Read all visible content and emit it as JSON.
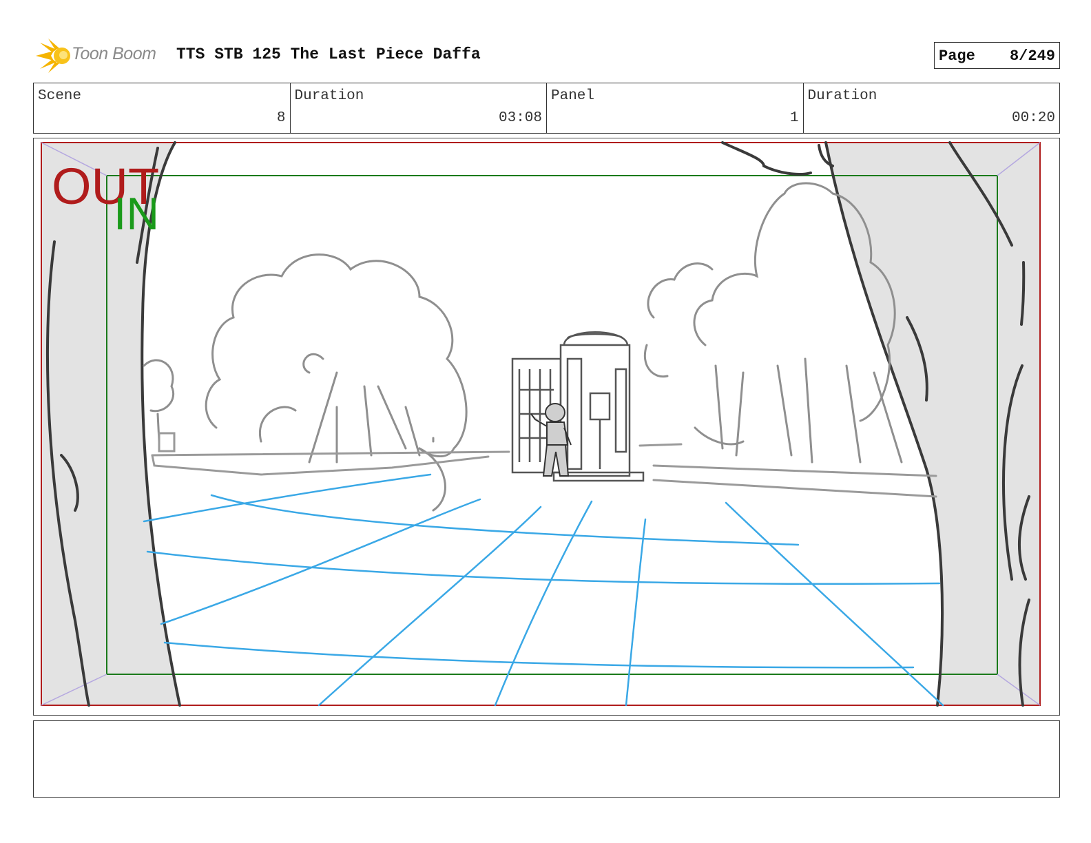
{
  "header": {
    "logo_text": "Toon Boom",
    "title": "TTS STB 125 The Last Piece Daffa",
    "page_label": "Page",
    "page_value": "8/249"
  },
  "info": {
    "scene_label": "Scene",
    "scene_value": "8",
    "scene_duration_label": "Duration",
    "scene_duration_value": "03:08",
    "panel_label": "Panel",
    "panel_value": "1",
    "panel_duration_label": "Duration",
    "panel_duration_value": "00:20"
  },
  "frame": {
    "out_label": "OUT",
    "in_label": "IN",
    "out_color": "#b01c1c",
    "in_color": "#1a9a1a",
    "guide_color": "#3aa8e6"
  },
  "caption": {
    "text": ""
  }
}
